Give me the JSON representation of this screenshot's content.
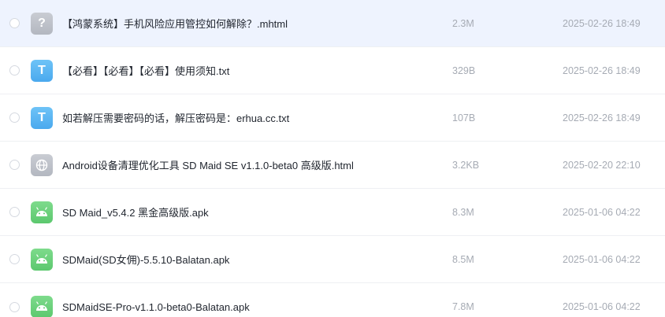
{
  "files": [
    {
      "name": "【鸿蒙系统】手机风险应用管控如何解除？.mhtml",
      "size": "2.3M",
      "date": "2025-02-26 18:49",
      "icon": "question-icon",
      "icon_glyph": "?",
      "selected": true
    },
    {
      "name": "【必看】【必看】【必看】使用须知.txt",
      "size": "329B",
      "date": "2025-02-26 18:49",
      "icon": "text-file-icon",
      "icon_glyph": "T",
      "selected": false
    },
    {
      "name": "如若解压需要密码的话，解压密码是：erhua.cc.txt",
      "size": "107B",
      "date": "2025-02-26 18:49",
      "icon": "text-file-icon",
      "icon_glyph": "T",
      "selected": false
    },
    {
      "name": "Android设备清理优化工具 SD Maid SE v1.1.0-beta0 高级版.html",
      "size": "3.2KB",
      "date": "2025-02-20 22:10",
      "icon": "globe-icon",
      "icon_glyph": "",
      "selected": false
    },
    {
      "name": "SD Maid_v5.4.2 黑金高级版.apk",
      "size": "8.3M",
      "date": "2025-01-06 04:22",
      "icon": "android-icon",
      "icon_glyph": "",
      "selected": false
    },
    {
      "name": "SDMaid(SD女佣)-5.5.10-Balatan.apk",
      "size": "8.5M",
      "date": "2025-01-06 04:22",
      "icon": "android-icon",
      "icon_glyph": "",
      "selected": false
    },
    {
      "name": "SDMaidSE-Pro-v1.1.0-beta0-Balatan.apk",
      "size": "7.8M",
      "date": "2025-01-06 04:22",
      "icon": "android-icon",
      "icon_glyph": "",
      "selected": false
    }
  ],
  "colors": {
    "selected_row": "#eef3fe",
    "text_icon": "#4aa9ee",
    "android_icon": "#5cc86e",
    "unknown_icon": "#b3b7c0",
    "meta_text": "#a6abb4"
  }
}
